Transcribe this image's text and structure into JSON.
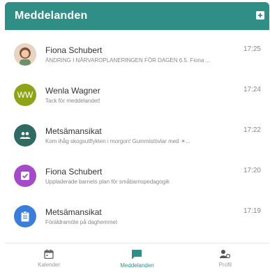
{
  "header": {
    "title": "Meddelanden"
  },
  "messages": [
    {
      "sender": "Fiona Schubert",
      "time": "17:25",
      "preview": "ÄNDRING I NÄRVAROPLANERINGEN FÖR DAGEN 6.5. Fiona ...",
      "avatar": {
        "type": "photo",
        "color": "#c9a27a"
      }
    },
    {
      "sender": "Wenla Wagner",
      "time": "17:24",
      "preview": "Tack för meddelandet!",
      "avatar": {
        "type": "initials",
        "initials": "WW",
        "color": "#8fa318"
      }
    },
    {
      "sender": "Metsämansikat",
      "time": "17:22",
      "preview": "Kom ihåg skogsutflykten i morgon! Gummistövlar med ☀...",
      "avatar": {
        "type": "group-icon",
        "color": "#2f6b62"
      }
    },
    {
      "sender": "Fiona Schubert",
      "time": "17:20",
      "preview": "Uppladerade barnets plan för småbarnspedagogik",
      "avatar": {
        "type": "checkbox-icon",
        "color": "#a54bc9"
      }
    },
    {
      "sender": "Metsämansikat",
      "time": "17:19",
      "preview": "Föräldramöte på daghemmet",
      "avatar": {
        "type": "clipboard-icon",
        "color": "#3b7ed9"
      }
    }
  ],
  "tabs": [
    {
      "label": "Kalender",
      "icon": "calendar-icon",
      "active": false
    },
    {
      "label": "Meddelanden",
      "icon": "chat-icon",
      "active": true
    },
    {
      "label": "Profil",
      "icon": "profile-icon",
      "active": false
    }
  ],
  "colors": {
    "brand": "#2f8f86",
    "inactive": "#999999"
  }
}
